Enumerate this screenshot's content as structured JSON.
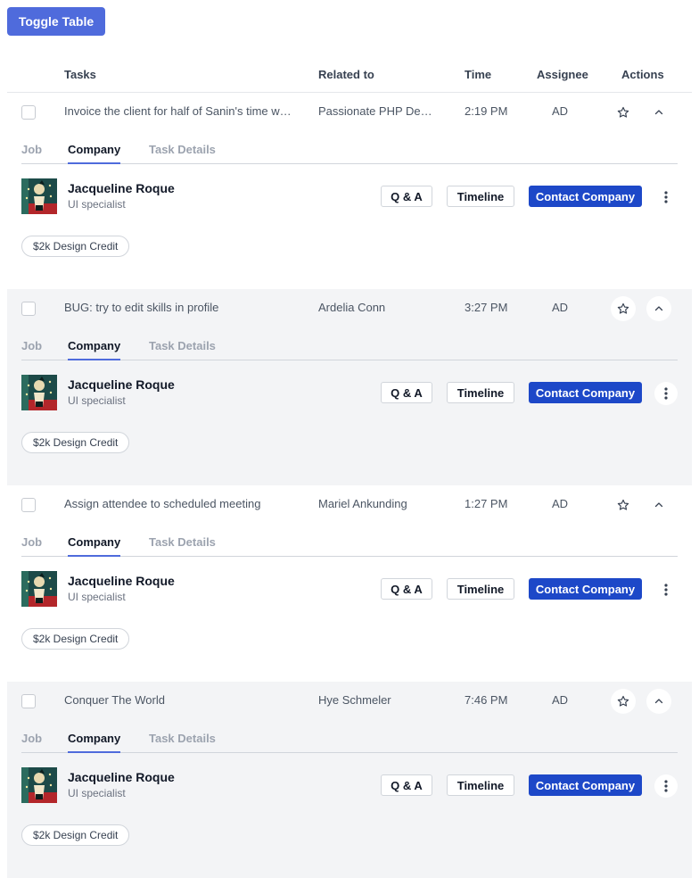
{
  "toolbar": {
    "toggle_label": "Toggle Table"
  },
  "table": {
    "headers": {
      "tasks": "Tasks",
      "related": "Related to",
      "time": "Time",
      "assignee": "Assignee",
      "actions": "Actions"
    },
    "rows": [
      {
        "task": "Invoice the client for half of Sanin's time worked",
        "related": "Passionate PHP Developer",
        "time": "2:19 PM",
        "assignee": "AD"
      },
      {
        "task": "BUG: try to edit skills in profile",
        "related": "Ardelia Conn",
        "time": "3:27 PM",
        "assignee": "AD"
      },
      {
        "task": "Assign attendee to scheduled meeting",
        "related": "Mariel Ankunding",
        "time": "1:27 PM",
        "assignee": "AD"
      },
      {
        "task": "Conquer The World",
        "related": "Hye Schmeler",
        "time": "7:46 PM",
        "assignee": "AD"
      }
    ]
  },
  "detail": {
    "tabs": {
      "job": "Job",
      "company": "Company",
      "task_details": "Task Details"
    },
    "person_name": "Jacqueline Roque",
    "person_role": "UI specialist",
    "qa_label": "Q & A",
    "timeline_label": "Timeline",
    "contact_label": "Contact Company",
    "badge_label": "$2k Design Credit"
  },
  "icons": {
    "star": "star-icon",
    "chevron": "chevron-up-icon",
    "more": "more-vertical-icon"
  },
  "colors": {
    "primary": "#4f6bdc",
    "contact": "#1d48c8",
    "shaded_row": "#f3f4f6"
  }
}
